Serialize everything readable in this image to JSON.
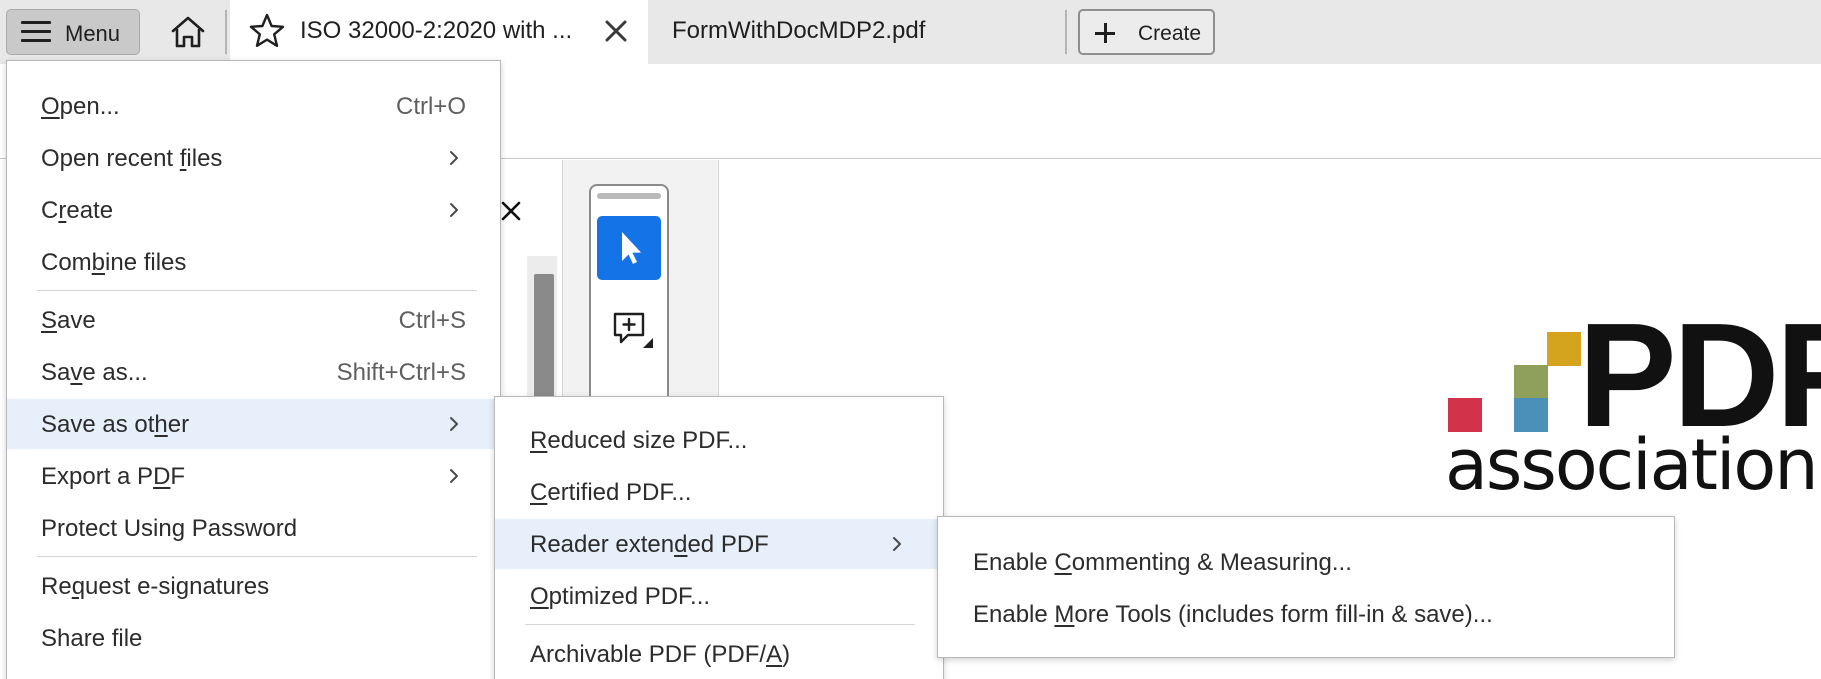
{
  "tabbar": {
    "menu_label": "Menu",
    "active_tab_title": "ISO 32000-2:2020 with ...",
    "second_tab_title": "FormWithDocMDP2.pdf",
    "create_label": "Create"
  },
  "logo": {
    "line1": "PDF",
    "line2": "association",
    "colors": [
      "#d4a41c",
      "#8fa05a",
      "#d3334a",
      "#4a90b8"
    ]
  },
  "main_menu": {
    "items": [
      {
        "pre": "",
        "u": "O",
        "post": "pen...",
        "shortcut": "Ctrl+O"
      },
      {
        "pre": "Open recent ",
        "u": "f",
        "post": "iles",
        "submenu": true
      },
      {
        "pre": "C",
        "u": "r",
        "post": "eate",
        "submenu": true
      },
      {
        "pre": "Com",
        "u": "b",
        "post": "ine files"
      },
      {
        "pre": "",
        "u": "S",
        "post": "ave",
        "shortcut": "Ctrl+S"
      },
      {
        "pre": "Sa",
        "u": "v",
        "post": "e as...",
        "shortcut": "Shift+Ctrl+S"
      },
      {
        "pre": "Save as ot",
        "u": "h",
        "post": "er",
        "submenu": true,
        "highlighted": true
      },
      {
        "pre": "Export a P",
        "u": "D",
        "post": "F",
        "submenu": true
      },
      {
        "pre": "Protect Using Password",
        "u": "",
        "post": ""
      },
      {
        "pre": "Re",
        "u": "q",
        "post": "uest e-signatures"
      },
      {
        "pre": "Share file",
        "u": "",
        "post": ""
      }
    ]
  },
  "save_as_other_menu": {
    "items": [
      {
        "pre": "",
        "u": "R",
        "post": "educed size PDF..."
      },
      {
        "pre": "",
        "u": "C",
        "post": "ertified PDF..."
      },
      {
        "pre": "Reader exten",
        "u": "d",
        "post": "ed PDF",
        "submenu": true,
        "highlighted": true
      },
      {
        "pre": "",
        "u": "O",
        "post": "ptimized PDF..."
      },
      {
        "pre": "Archivable PDF (PDF/",
        "u": "A",
        "post": ")"
      }
    ]
  },
  "reader_extended_menu": {
    "items": [
      {
        "pre": "Enable ",
        "u": "C",
        "post": "ommenting & Measuring..."
      },
      {
        "pre": "Enable ",
        "u": "M",
        "post": "ore Tools (includes form fill-in & save)..."
      }
    ]
  }
}
